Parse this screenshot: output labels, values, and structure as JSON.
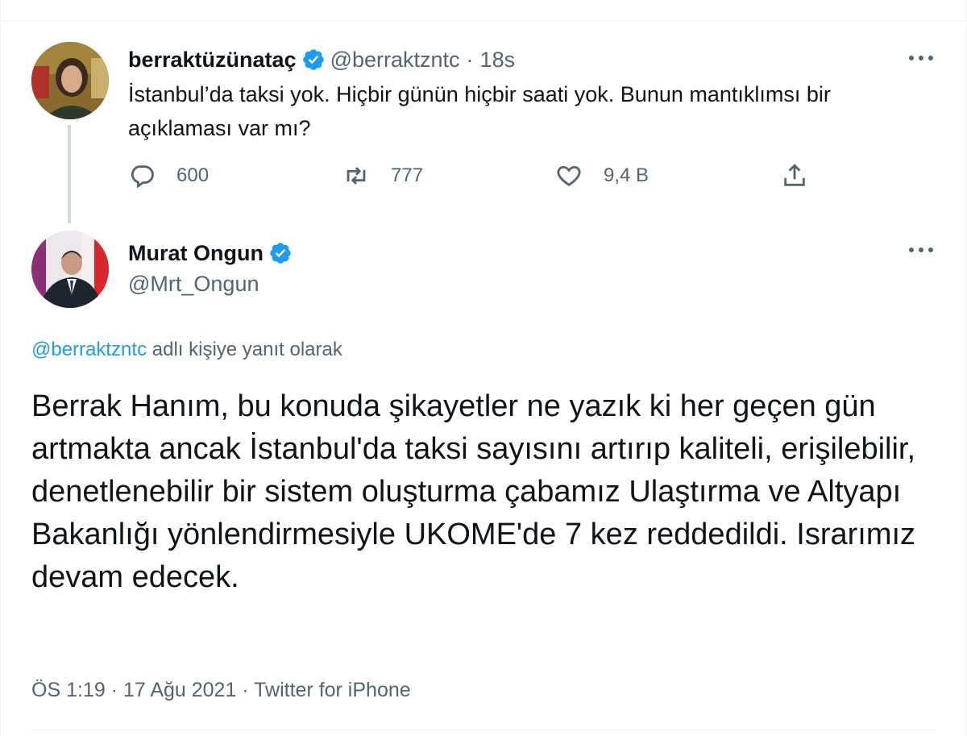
{
  "parent_tweet": {
    "display_name": "berraktüzünataç",
    "handle": "@berraktzntc",
    "separator": "·",
    "time": "18s",
    "text": "İstanbul’da taksi yok. Hiçbir günün hiçbir saati yok. Bunun mantıklımsı bir açıklaması var mı?",
    "reply_count": "600",
    "retweet_count": "777",
    "like_count": "9,4 B"
  },
  "reply_tweet": {
    "display_name": "Murat Ongun",
    "handle": "@Mrt_Ongun",
    "reply_to_mention": "@berraktzntc",
    "reply_to_suffix": " adlı kişiye yanıt olarak",
    "text": "Berrak Hanım, bu konuda şikayetler ne yazık ki her geçen gün artmakta ancak İstanbul'da taksi sayısını artırıp kaliteli, erişilebilir, denetlenebilir bir sistem oluşturma çabamız Ulaştırma ve Altyapı Bakanlığı yönlendirmesiyle UKOME'de 7 kez reddedildi. Israrımız devam edecek.",
    "meta": "ÖS 1:19 · 17 Ağu 2021 · Twitter for iPhone"
  },
  "icons": {
    "verified": "verified-badge-icon",
    "reply": "reply-icon",
    "retweet": "retweet-icon",
    "like": "heart-icon",
    "share": "share-icon",
    "more": "more-icon"
  },
  "colors": {
    "accent": "#1d9bf0",
    "secondary_text": "#536471",
    "primary_text": "#0f1419",
    "thread_line": "#cfd9de"
  }
}
